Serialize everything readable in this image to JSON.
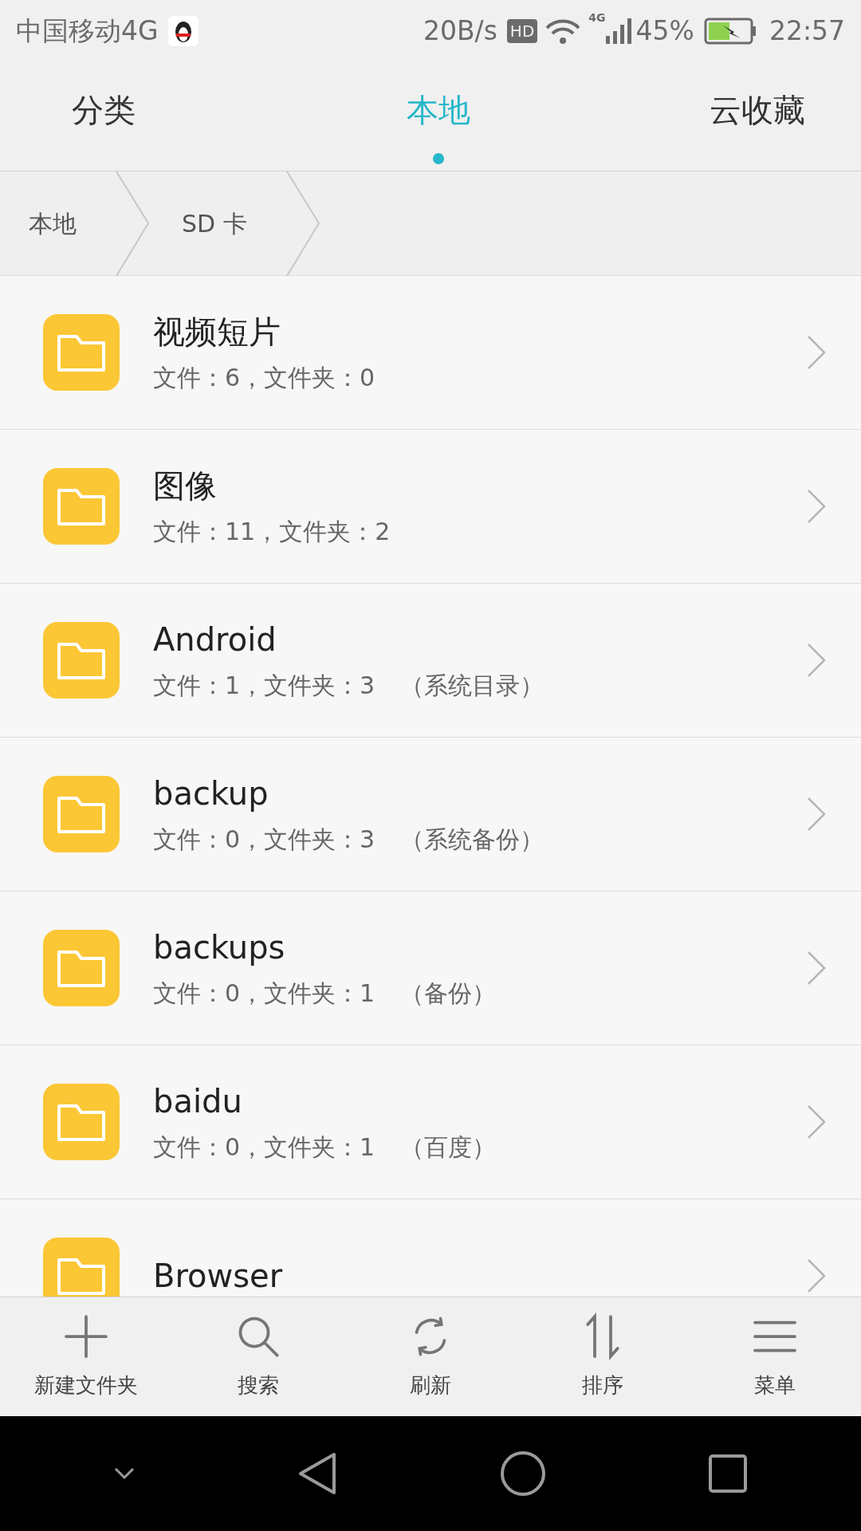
{
  "status_bar": {
    "carrier": "中国移动4G",
    "speed": "20B/s",
    "hd": "HD",
    "network": "4G",
    "battery": "45%",
    "time": "22:57"
  },
  "tabs": [
    {
      "label": "分类",
      "selected": false
    },
    {
      "label": "本地",
      "selected": true
    },
    {
      "label": "云收藏",
      "selected": false
    }
  ],
  "breadcrumb": [
    "本地",
    "SD 卡"
  ],
  "folders": [
    {
      "name": "视频短片",
      "info": "文件：6，文件夹：0"
    },
    {
      "name": "图像",
      "info": "文件：11，文件夹：2"
    },
    {
      "name": "Android",
      "info": "文件：1，文件夹：3",
      "note": "（系统目录）"
    },
    {
      "name": "backup",
      "info": "文件：0，文件夹：3",
      "note": "（系统备份）"
    },
    {
      "name": "backups",
      "info": "文件：0，文件夹：1",
      "note": "（备份）"
    },
    {
      "name": "baidu",
      "info": "文件：0，文件夹：1",
      "note": "（百度）"
    },
    {
      "name": "Browser"
    }
  ],
  "toolbar": [
    {
      "kind": "add",
      "label": "新建文件夹"
    },
    {
      "kind": "search",
      "label": "搜索"
    },
    {
      "kind": "refresh",
      "label": "刷新"
    },
    {
      "kind": "sort",
      "label": "排序"
    },
    {
      "kind": "menu",
      "label": "菜单"
    }
  ]
}
